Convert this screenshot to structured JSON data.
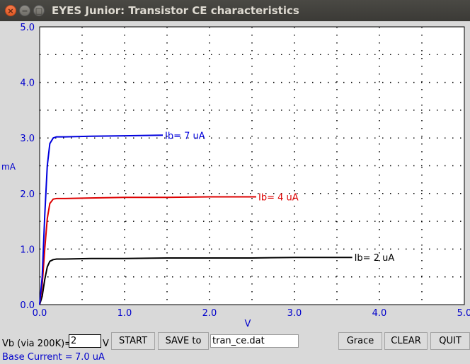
{
  "window": {
    "title": "EYES Junior: Transistor CE characteristics",
    "close_glyph": "×",
    "min_glyph": "−",
    "max_glyph": "□"
  },
  "chart_data": {
    "type": "line",
    "xlabel": "V",
    "ylabel": "mA",
    "xlim": [
      0,
      5
    ],
    "ylim": [
      0,
      5
    ],
    "xticks": [
      "0.0",
      "1.0",
      "2.0",
      "3.0",
      "4.0",
      "5.0"
    ],
    "yticks": [
      "0.0",
      "1.0",
      "2.0",
      "3.0",
      "4.0",
      "5.0"
    ],
    "grid": true,
    "series": [
      {
        "name": "Ib=  2 uA",
        "label": "Ib=  2 uA",
        "color": "#000000",
        "x": [
          0,
          0.03,
          0.06,
          0.09,
          0.12,
          0.16,
          0.2,
          0.3,
          0.6,
          1.0,
          1.5,
          2.0,
          2.5,
          3.0,
          3.5,
          3.68
        ],
        "y": [
          0,
          0.15,
          0.45,
          0.68,
          0.78,
          0.81,
          0.82,
          0.82,
          0.83,
          0.83,
          0.84,
          0.84,
          0.84,
          0.85,
          0.85,
          0.85
        ]
      },
      {
        "name": "Ib=  4 uA",
        "label": "Ib=  4 uA",
        "color": "#dd0000",
        "x": [
          0,
          0.03,
          0.06,
          0.09,
          0.12,
          0.16,
          0.2,
          0.3,
          0.6,
          1.0,
          1.5,
          2.0,
          2.5,
          2.55
        ],
        "y": [
          0,
          0.35,
          1.0,
          1.55,
          1.82,
          1.9,
          1.91,
          1.91,
          1.92,
          1.93,
          1.93,
          1.94,
          1.94,
          1.94
        ]
      },
      {
        "name": "Ib=  7 uA",
        "label": "Ib=  7 uA",
        "color": "#0000dd",
        "x": [
          0,
          0.03,
          0.06,
          0.09,
          0.12,
          0.16,
          0.2,
          0.3,
          0.6,
          1.0,
          1.45
        ],
        "y": [
          0,
          0.5,
          1.6,
          2.5,
          2.9,
          3.0,
          3.02,
          3.02,
          3.03,
          3.04,
          3.05
        ]
      }
    ]
  },
  "controls": {
    "vb_label": "Vb (via 200K)=",
    "vb_value": "2",
    "vb_unit": "V",
    "start_label": "START",
    "save_label": "SAVE to",
    "filename": "tran_ce.dat",
    "grace_label": "Grace",
    "clear_label": "CLEAR",
    "quit_label": "QUIT",
    "base_current_label": "Base Current =",
    "base_current_value": "7.0 uA"
  },
  "colors": {
    "axis_blue": "#0000cc",
    "background": "#d9d9d9"
  }
}
